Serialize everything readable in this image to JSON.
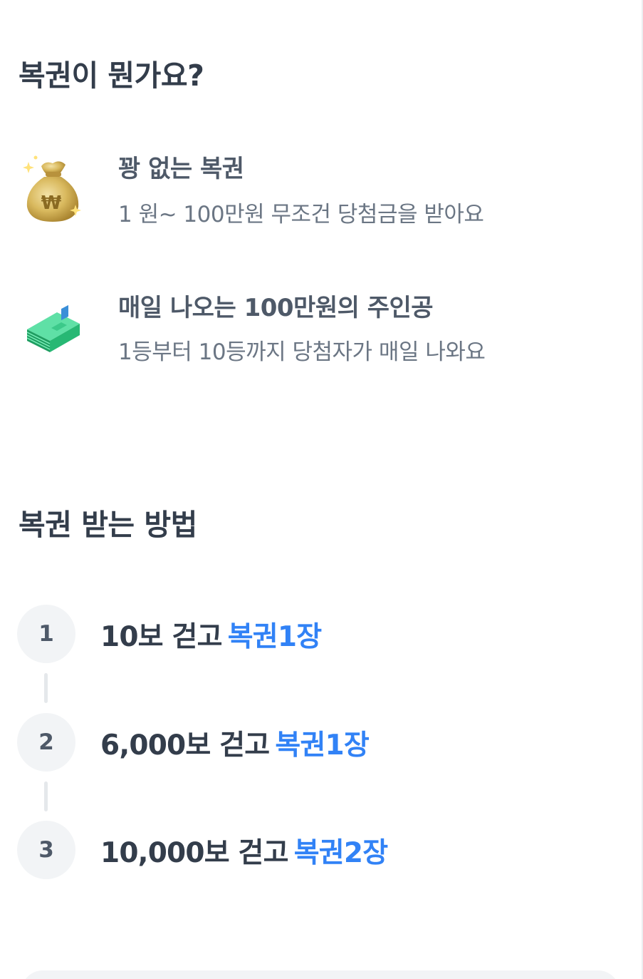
{
  "section1": {
    "title": "복권이 뭔가요?",
    "features": [
      {
        "icon": "money-bag-icon",
        "name": "꽝 없는 복권",
        "description": "1 원~ 100만원 무조건 당첨금을 받아요"
      },
      {
        "icon": "cash-stack-icon",
        "name": "매일 나오는 100만원의 주인공",
        "description": "1등부터 10등까지 당첨자가 매일 나와요"
      }
    ]
  },
  "section2": {
    "title": "복권 받는 방법",
    "steps": [
      {
        "number": "1",
        "text": "10보 걷고",
        "reward": "복권1장"
      },
      {
        "number": "2",
        "text": "6,000보 걷고",
        "reward": "복권1장"
      },
      {
        "number": "3",
        "text": "10,000보 걷고",
        "reward": "복권2장"
      }
    ]
  },
  "colors": {
    "accent": "#3182f6",
    "title": "#333d4b",
    "subtitle": "#6b7684",
    "step_circle": "#f2f4f6"
  }
}
